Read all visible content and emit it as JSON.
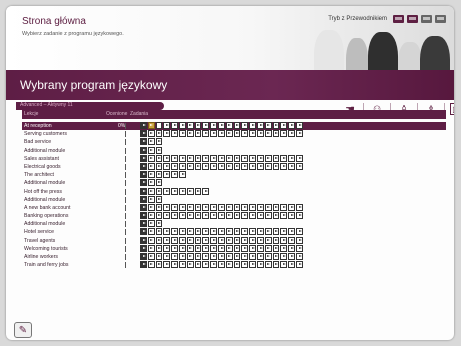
{
  "header": {
    "title": "Strona główna",
    "subtitle": "Wybierz zadanie z programu językowego.",
    "guide_label": "Tryb z Przewodnikiem"
  },
  "banner": {
    "title": "Wybrany program językowy"
  },
  "subbar": {
    "text": "Advanced – Aktywny 11"
  },
  "table": {
    "headers": {
      "lesson": "Lekcje",
      "progress": "Ocenione",
      "tasks": "Zadania"
    },
    "rows": [
      {
        "name": "At reception",
        "pct": "0%",
        "cells": 21,
        "selected": true
      },
      {
        "name": "Serving customers",
        "pct": "",
        "cells": 21
      },
      {
        "name": "Bad service",
        "pct": "",
        "cells": 3
      },
      {
        "name": "Additional module",
        "pct": "",
        "cells": 3
      },
      {
        "name": "Sales assistant",
        "pct": "",
        "cells": 21
      },
      {
        "name": "Electrical goods",
        "pct": "",
        "cells": 21
      },
      {
        "name": "The architect",
        "pct": "",
        "cells": 6
      },
      {
        "name": "Additional module",
        "pct": "",
        "cells": 3
      },
      {
        "name": "Hot off the press",
        "pct": "",
        "cells": 9
      },
      {
        "name": "Additional module",
        "pct": "",
        "cells": 3
      },
      {
        "name": "A new bank account",
        "pct": "",
        "cells": 21
      },
      {
        "name": "Banking operations",
        "pct": "",
        "cells": 21
      },
      {
        "name": "Additional module",
        "pct": "",
        "cells": 3
      },
      {
        "name": "Hotel service",
        "pct": "",
        "cells": 21
      },
      {
        "name": "Travel agents",
        "pct": "",
        "cells": 21
      },
      {
        "name": "Welcoming tourists",
        "pct": "",
        "cells": 21
      },
      {
        "name": "Airline workers",
        "pct": "",
        "cells": 21
      },
      {
        "name": "Train and ferry jobs",
        "pct": "",
        "cells": 21
      }
    ]
  },
  "icons": {
    "toolbar": [
      "hand-icon",
      "head-icon",
      "people-icon",
      "people-talk-icon",
      "exit-icon"
    ],
    "corner": "pencil-icon"
  },
  "colors": {
    "brand": "#5e1e45",
    "gold": "#c9a13b"
  }
}
